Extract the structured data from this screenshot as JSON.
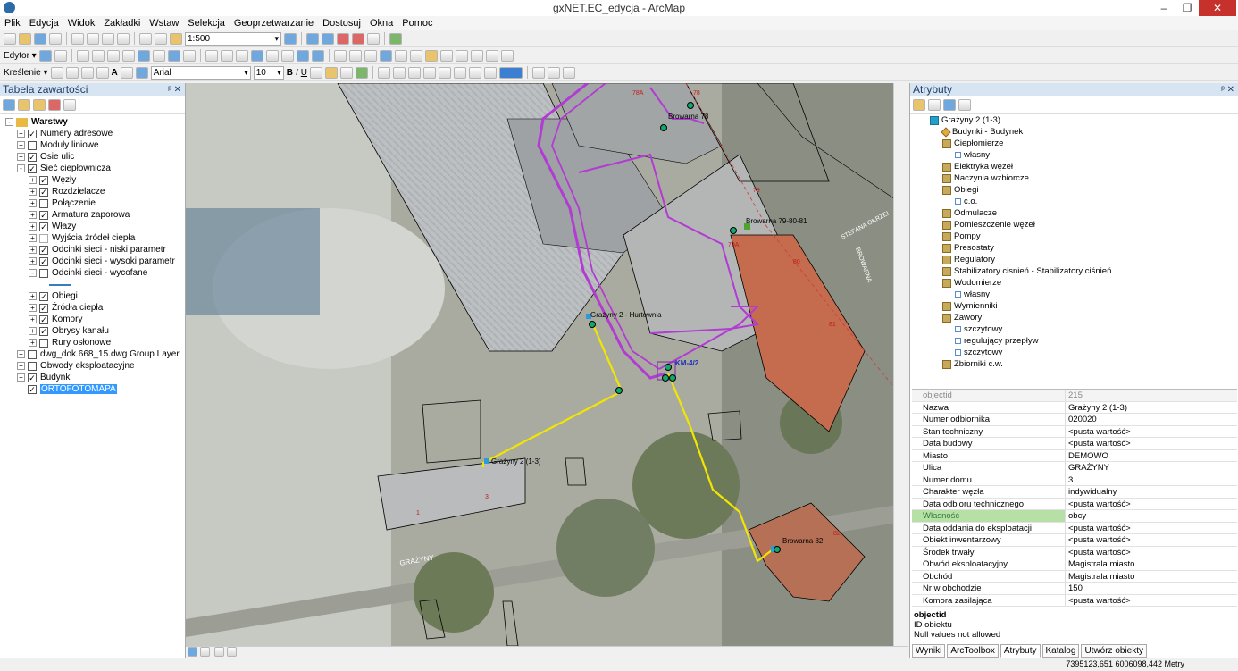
{
  "window": {
    "title": "gxNET.EC_edycja - ArcMap",
    "min": "–",
    "max": "❐",
    "close": "✕"
  },
  "menu": [
    "Plik",
    "Edycja",
    "Widok",
    "Zakładki",
    "Wstaw",
    "Selekcja",
    "Geoprzetwarzanie",
    "Dostosuj",
    "Okna",
    "Pomoc"
  ],
  "toolbar1": {
    "scale": "1:500"
  },
  "toolbar2": {
    "editor": "Edytor ▾"
  },
  "toolbar3": {
    "drawing": "Kreślenie ▾",
    "font": "Arial",
    "size": "10",
    "bold": "B",
    "italic": "I",
    "underline": "U",
    "text_a": "A"
  },
  "toc": {
    "title": "Tabela zawartości",
    "pin": "ᵖ ✕",
    "items": [
      {
        "label": "Warstwy",
        "level": 0,
        "exp": "-",
        "chk": null,
        "bold": true
      },
      {
        "label": "Numery adresowe",
        "level": 1,
        "exp": "+",
        "chk": "✓"
      },
      {
        "label": "Moduły liniowe",
        "level": 1,
        "exp": "+",
        "chk": ""
      },
      {
        "label": "Osie ulic",
        "level": 1,
        "exp": "+",
        "chk": "✓"
      },
      {
        "label": "Sieć ciepłownicza",
        "level": 1,
        "exp": "-",
        "chk": "✓"
      },
      {
        "label": "Węzły",
        "level": 2,
        "exp": "+",
        "chk": "✓"
      },
      {
        "label": "Rozdzielacze",
        "level": 2,
        "exp": "+",
        "chk": "✓"
      },
      {
        "label": "Połączenie",
        "level": 2,
        "exp": "+",
        "chk": ""
      },
      {
        "label": "Armatura zaporowa",
        "level": 2,
        "exp": "+",
        "chk": "✓"
      },
      {
        "label": "Włazy",
        "level": 2,
        "exp": "+",
        "chk": "✓"
      },
      {
        "label": "Wyjścia źródeł ciepła",
        "level": 2,
        "exp": "+",
        "chk": "dim"
      },
      {
        "label": "Odcinki sieci - niski parametr",
        "level": 2,
        "exp": "+",
        "chk": "✓"
      },
      {
        "label": "Odcinki sieci - wysoki parametr",
        "level": 2,
        "exp": "+",
        "chk": "✓"
      },
      {
        "label": "Odcinki sieci - wycofane",
        "level": 2,
        "exp": "-",
        "chk": ""
      },
      {
        "label": "",
        "level": 3,
        "exp": null,
        "chk": null,
        "line": true
      },
      {
        "label": "Obiegi",
        "level": 2,
        "exp": "+",
        "chk": "✓"
      },
      {
        "label": "Źródła ciepła",
        "level": 2,
        "exp": "+",
        "chk": "✓"
      },
      {
        "label": "Komory",
        "level": 2,
        "exp": "+",
        "chk": "✓"
      },
      {
        "label": "Obrysy kanału",
        "level": 2,
        "exp": "+",
        "chk": "✓"
      },
      {
        "label": "Rury osłonowe",
        "level": 2,
        "exp": "+",
        "chk": ""
      },
      {
        "label": "dwg_dok.668_15.dwg Group Layer",
        "level": 1,
        "exp": "+",
        "chk": ""
      },
      {
        "label": "Obwody eksploatacyjne",
        "level": 1,
        "exp": "+",
        "chk": ""
      },
      {
        "label": "Budynki",
        "level": 1,
        "exp": "+",
        "chk": "✓"
      },
      {
        "label": "ORTOFOTOMAPA",
        "level": 1,
        "exp": null,
        "chk": "✓",
        "selected": true
      }
    ]
  },
  "map": {
    "labels": {
      "browarna78": "Browarna 78",
      "browarna7981": "Browarna 79-80-81",
      "hurtownia": "Grażyny 2 - Hurtownia",
      "km42": "KM-4/2",
      "grazyny213": "Grażyny 2 (1-3)",
      "browarna82": "Browarna 82",
      "stefana": "STEFANA OKRZEI",
      "browarna_st": "BROWARNA",
      "grazyny_st": "GRAŻYNY",
      "n78a": "78A",
      "n78": "78",
      "n79": "79",
      "n79a": "79A",
      "n80": "80",
      "n81": "81",
      "n82": "82",
      "n1": "1",
      "n3": "3"
    }
  },
  "attrs": {
    "title": "Atrybuty",
    "pin": "ᵖ ✕",
    "tree": [
      {
        "label": "Grażyny 2 (1-3)",
        "level": 0,
        "icon": "root"
      },
      {
        "label": "Budynki - Budynek",
        "level": 1,
        "icon": "bld"
      },
      {
        "label": "Ciepłomierze",
        "level": 1,
        "icon": "tbl"
      },
      {
        "label": "własny",
        "level": 2,
        "icon": "obj"
      },
      {
        "label": "Elektryka węzeł",
        "level": 1,
        "icon": "tbl"
      },
      {
        "label": "Naczynia wzbiorcze",
        "level": 1,
        "icon": "tbl"
      },
      {
        "label": "Obiegi",
        "level": 1,
        "icon": "tbl"
      },
      {
        "label": "c.o.",
        "level": 2,
        "icon": "obj"
      },
      {
        "label": "Odmulacze",
        "level": 1,
        "icon": "tbl"
      },
      {
        "label": "Pomieszczenie węzeł",
        "level": 1,
        "icon": "tbl"
      },
      {
        "label": "Pompy",
        "level": 1,
        "icon": "tbl"
      },
      {
        "label": "Presostaty",
        "level": 1,
        "icon": "tbl"
      },
      {
        "label": "Regulatory",
        "level": 1,
        "icon": "tbl"
      },
      {
        "label": "Stabilizatory cisnień - Stabilizatory ciśnień",
        "level": 1,
        "icon": "tbl"
      },
      {
        "label": "Wodomierze",
        "level": 1,
        "icon": "tbl"
      },
      {
        "label": "własny",
        "level": 2,
        "icon": "obj"
      },
      {
        "label": "Wymienniki",
        "level": 1,
        "icon": "tbl"
      },
      {
        "label": "Zawory",
        "level": 1,
        "icon": "tbl"
      },
      {
        "label": "szczytowy",
        "level": 2,
        "icon": "obj"
      },
      {
        "label": "regulujący przepływ",
        "level": 2,
        "icon": "obj"
      },
      {
        "label": "szczytowy",
        "level": 2,
        "icon": "obj"
      },
      {
        "label": "Zbiorniki c.w.",
        "level": 1,
        "icon": "tbl"
      }
    ],
    "grid": [
      {
        "k": "objectid",
        "v": "215",
        "hdr": true
      },
      {
        "k": "Nazwa",
        "v": "Grażyny 2 (1-3)"
      },
      {
        "k": "Numer odbiornika",
        "v": "020020"
      },
      {
        "k": "Stan techniczny",
        "v": "<pusta wartość>"
      },
      {
        "k": "Data budowy",
        "v": "<pusta wartość>"
      },
      {
        "k": "Miasto",
        "v": "DEMOWO"
      },
      {
        "k": "Ulica",
        "v": "GRAŻYNY"
      },
      {
        "k": "Numer domu",
        "v": "3"
      },
      {
        "k": "Charakter węzła",
        "v": "indywidualny"
      },
      {
        "k": "Data odbioru technicznego",
        "v": "<pusta wartość>"
      },
      {
        "k": "Własność",
        "v": "obcy",
        "hl": true
      },
      {
        "k": "Data oddania do eksploatacji",
        "v": "<pusta wartość>"
      },
      {
        "k": "Obiekt inwentarzowy",
        "v": "<pusta wartość>"
      },
      {
        "k": "Środek trwały",
        "v": "<pusta wartość>"
      },
      {
        "k": "Obwód eksploatacyjny",
        "v": "Magistrala miasto"
      },
      {
        "k": "Obchód",
        "v": "Magistrala miasto"
      },
      {
        "k": "Nr w obchodzie",
        "v": "150"
      },
      {
        "k": "Komora zasilająca",
        "v": "<pusta wartość>"
      }
    ],
    "desc": {
      "field": "objectid",
      "line1": "ID obiektu",
      "line2": "Null values not allowed"
    }
  },
  "tabs": [
    "Wyniki",
    "ArcToolbox",
    "Atrybuty",
    "Katalog",
    "Utwórz obiekty"
  ],
  "status": {
    "coords": "7395123,651  6006098,442 Metry"
  }
}
